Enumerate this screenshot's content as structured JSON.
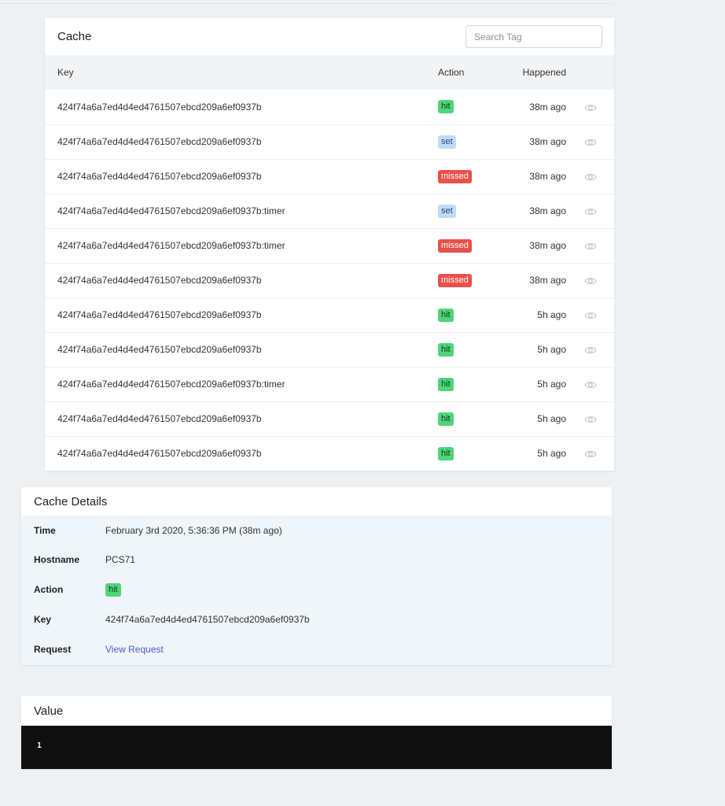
{
  "cache": {
    "title": "Cache",
    "search_placeholder": "Search Tag",
    "columns": {
      "key": "Key",
      "action": "Action",
      "happened": "Happened"
    },
    "rows": [
      {
        "key": "424f74a6a7ed4d4ed4761507ebcd209a6ef0937b",
        "action": "hit",
        "happened": "38m ago"
      },
      {
        "key": "424f74a6a7ed4d4ed4761507ebcd209a6ef0937b",
        "action": "set",
        "happened": "38m ago"
      },
      {
        "key": "424f74a6a7ed4d4ed4761507ebcd209a6ef0937b",
        "action": "missed",
        "happened": "38m ago"
      },
      {
        "key": "424f74a6a7ed4d4ed4761507ebcd209a6ef0937b:timer",
        "action": "set",
        "happened": "38m ago"
      },
      {
        "key": "424f74a6a7ed4d4ed4761507ebcd209a6ef0937b:timer",
        "action": "missed",
        "happened": "38m ago"
      },
      {
        "key": "424f74a6a7ed4d4ed4761507ebcd209a6ef0937b",
        "action": "missed",
        "happened": "38m ago"
      },
      {
        "key": "424f74a6a7ed4d4ed4761507ebcd209a6ef0937b",
        "action": "hit",
        "happened": "5h ago"
      },
      {
        "key": "424f74a6a7ed4d4ed4761507ebcd209a6ef0937b",
        "action": "hit",
        "happened": "5h ago"
      },
      {
        "key": "424f74a6a7ed4d4ed4761507ebcd209a6ef0937b:timer",
        "action": "hit",
        "happened": "5h ago"
      },
      {
        "key": "424f74a6a7ed4d4ed4761507ebcd209a6ef0937b",
        "action": "hit",
        "happened": "5h ago"
      },
      {
        "key": "424f74a6a7ed4d4ed4761507ebcd209a6ef0937b",
        "action": "hit",
        "happened": "5h ago"
      }
    ]
  },
  "details": {
    "title": "Cache Details",
    "time_label": "Time",
    "time_value": "February 3rd 2020, 5:36:36 PM (38m ago)",
    "hostname_label": "Hostname",
    "hostname_value": "PCS71",
    "action_label": "Action",
    "action_value": "hit",
    "key_label": "Key",
    "key_value": "424f74a6a7ed4d4ed4761507ebcd209a6ef0937b",
    "request_label": "Request",
    "request_link": "View Request"
  },
  "value": {
    "title": "Value",
    "content": "1"
  },
  "colors": {
    "hit": "#4fd57a",
    "set": "#bfdcf7",
    "missed": "#e8504a",
    "link": "#4a5bd1"
  },
  "icons": {
    "row_action": "eye-icon"
  }
}
